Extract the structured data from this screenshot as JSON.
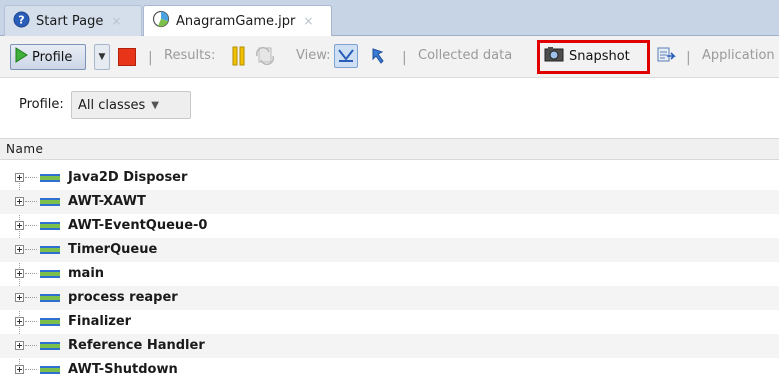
{
  "tabs": [
    {
      "label": "Start Page",
      "close": "×"
    },
    {
      "label": "AnagramGame.jpr",
      "close": "×"
    }
  ],
  "toolbar": {
    "profile_label": "Profile",
    "results_label": "Results:",
    "view_label": "View:",
    "collected_label": "Collected data",
    "snapshot_label": "Snapshot",
    "application_label": "Application",
    "separator": "|"
  },
  "profile_row": {
    "label": "Profile:",
    "selected": "All classes"
  },
  "table": {
    "column_name": "Name",
    "rows": [
      "Java2D Disposer",
      "AWT-XAWT",
      "AWT-EventQueue-0",
      "TimerQueue",
      "main",
      "process reaper",
      "Finalizer",
      "Reference Handler",
      "AWT-Shutdown"
    ]
  },
  "colors": {
    "tabbar_bg": "#c7d4e6",
    "highlight_box": "#e00000",
    "stop_red": "#e8351a",
    "pause_yellow": "#f2c200"
  }
}
